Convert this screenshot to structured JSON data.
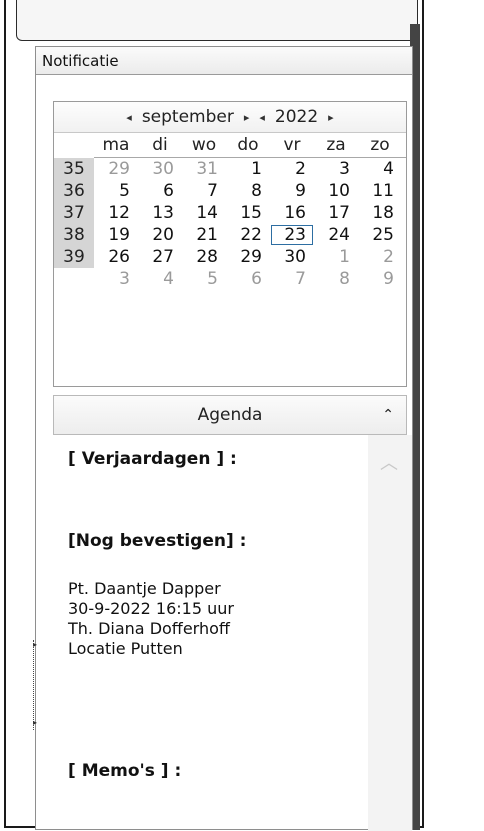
{
  "notification": {
    "title": "Notificatie"
  },
  "calendar": {
    "month": "september",
    "year": "2022",
    "weekdays": [
      "ma",
      "di",
      "wo",
      "do",
      "vr",
      "za",
      "zo"
    ],
    "weeks": [
      {
        "wk": "35",
        "days": [
          "29",
          "30",
          "31",
          "1",
          "2",
          "3",
          "4"
        ],
        "other": [
          true,
          true,
          true,
          false,
          false,
          false,
          false
        ]
      },
      {
        "wk": "36",
        "days": [
          "5",
          "6",
          "7",
          "8",
          "9",
          "10",
          "11"
        ],
        "other": [
          false,
          false,
          false,
          false,
          false,
          false,
          false
        ]
      },
      {
        "wk": "37",
        "days": [
          "12",
          "13",
          "14",
          "15",
          "16",
          "17",
          "18"
        ],
        "other": [
          false,
          false,
          false,
          false,
          false,
          false,
          false
        ]
      },
      {
        "wk": "38",
        "days": [
          "19",
          "20",
          "21",
          "22",
          "23",
          "24",
          "25"
        ],
        "other": [
          false,
          false,
          false,
          false,
          false,
          false,
          false
        ]
      },
      {
        "wk": "39",
        "days": [
          "26",
          "27",
          "28",
          "29",
          "30",
          "1",
          "2"
        ],
        "other": [
          false,
          false,
          false,
          false,
          false,
          true,
          true
        ]
      },
      {
        "wk": "",
        "days": [
          "3",
          "4",
          "5",
          "6",
          "7",
          "8",
          "9"
        ],
        "other": [
          true,
          true,
          true,
          true,
          true,
          true,
          true
        ]
      }
    ],
    "selected_day": "23"
  },
  "agenda": {
    "title": "Agenda",
    "collapse_icon": "double-chevron-up-icon",
    "section_birthdays": "[ Verjaardagen ] :",
    "section_confirm": "[Nog bevestigen] :",
    "appointment": [
      "Pt. Daantje Dapper",
      "30-9-2022 16:15 uur",
      "Th. Diana Dofferhoff",
      "Locatie Putten"
    ],
    "section_memos": "[ Memo's ] :"
  },
  "icons": {
    "prev": "chevron-left-icon",
    "next": "chevron-right-icon",
    "scroll_up": "chevron-up-icon"
  }
}
